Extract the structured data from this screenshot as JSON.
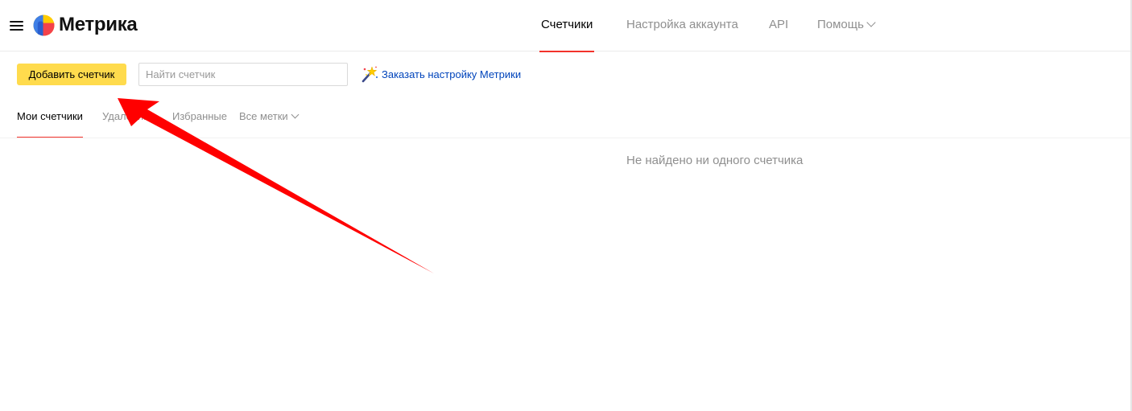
{
  "header": {
    "logo_text": "Метрика",
    "menu_icon": "menu-icon",
    "logo_icon": "metrika-logo-icon",
    "nav": [
      {
        "label": "Счетчики",
        "active": true
      },
      {
        "label": "Настройка аккаунта",
        "active": false
      },
      {
        "label": "API",
        "active": false
      },
      {
        "label": "Помощь",
        "active": false,
        "has_dropdown": true
      }
    ]
  },
  "toolbar": {
    "add_counter_label": "Добавить счетчик",
    "search_placeholder": "Найти счетчик",
    "search_value": "",
    "order_setup_label": "Заказать настройку Метрики",
    "order_setup_icon": "magic-wand-icon"
  },
  "tabs": [
    {
      "label": "Мои счетчики",
      "active": true
    },
    {
      "label": "Удаленные",
      "active": false
    },
    {
      "label": "Избранные",
      "active": false
    },
    {
      "label": "Все метки",
      "active": false,
      "has_dropdown": true
    }
  ],
  "main": {
    "empty_message": "Не найдено ни одного счетчика"
  },
  "colors": {
    "accent_yellow": "#ffdb4d",
    "active_underline": "#f2322b",
    "link_blue": "#0044bb",
    "annotation_arrow": "#ff0000"
  }
}
